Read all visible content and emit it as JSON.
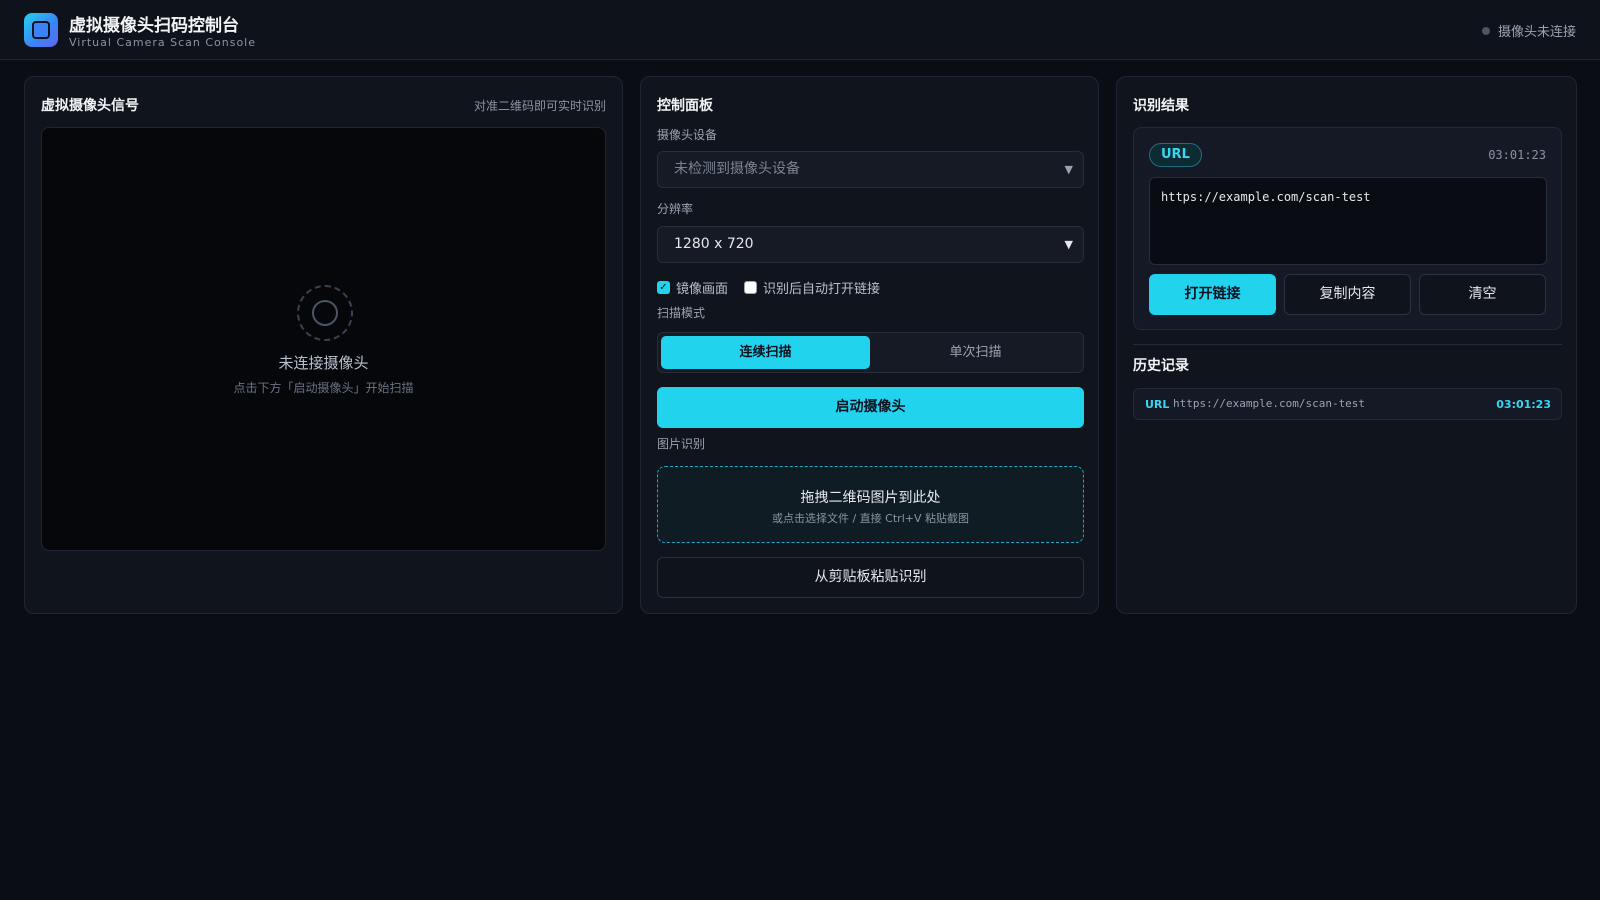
{
  "header": {
    "title": "虚拟摄像头扫码控制台",
    "subtitle": "Virtual Camera Scan Console",
    "status": "摄像头未连接"
  },
  "camera_panel": {
    "title": "虚拟摄像头信号",
    "hint": "对准二维码即可实时识别",
    "placeholder_title": "未连接摄像头",
    "placeholder_subtitle": "点击下方「启动摄像头」开始扫描"
  },
  "control_panel": {
    "title": "控制面板",
    "device_label": "摄像头设备",
    "device_value": "未检测到摄像头设备",
    "resolution_label": "分辨率",
    "resolution_value": "1280 x 720",
    "mirror": {
      "label": "镜像画面",
      "checked": true
    },
    "auto_open": {
      "label": "识别后自动打开链接",
      "checked": false
    },
    "scan_mode_label": "扫描模式",
    "scan_modes": [
      "连续扫描",
      "单次扫描"
    ],
    "start_button": "启动摄像头",
    "image_label": "图片识别",
    "dropzone_title": "拖拽二维码图片到此处",
    "dropzone_subtitle": "或点击选择文件 / 直接 Ctrl+V 粘贴截图",
    "paste_button": "从剪贴板粘贴识别"
  },
  "result_panel": {
    "title": "识别结果",
    "type_badge": "URL",
    "time": "03:01:23",
    "content": "https://example.com/scan-test",
    "open_button": "打开链接",
    "copy_button": "复制内容",
    "clear_button": "清空"
  },
  "history": {
    "title": "历史记录",
    "items": [
      {
        "type": "URL",
        "text": "https://example.com/scan-test",
        "time": "03:01:23"
      }
    ]
  },
  "colors": {
    "accent": "#22d3ee",
    "background": "#0a0d14",
    "card": "#10141d",
    "status_dot": "#4b5563"
  }
}
